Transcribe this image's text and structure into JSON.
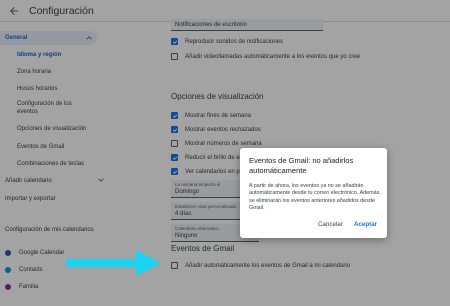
{
  "header": {
    "title": "Configuración",
    "back_icon": "arrow-back-icon"
  },
  "sidebar": {
    "general": "General",
    "sub_items": [
      "Idioma y región",
      "Zona horaria",
      "Husos horarios",
      "Configuración de los eventos",
      "Opciones de visualización",
      "Eventos de Gmail",
      "Combinaciones de teclas"
    ],
    "add_calendar": "Añadir calendario",
    "import_export": "Importar y exportar",
    "my_calendars_heading": "Configuración de mis calendarios",
    "calendars": [
      {
        "name": "Google Calendar",
        "color": "#3f51b5"
      },
      {
        "name": "Contacts",
        "color": "#039be5"
      },
      {
        "name": "Familia",
        "color": "#8e24aa"
      }
    ]
  },
  "main": {
    "notif_field": "Notificaciones de escritorio",
    "notif_options": [
      {
        "label": "Reproducir sonidos de notificaciones",
        "checked": true
      },
      {
        "label": "Añadir videollamadas automáticamente a los eventos que yo cree",
        "checked": false
      }
    ],
    "view_title": "Opciones de visualización",
    "view_options": [
      {
        "label": "Mostrar fines de semana",
        "checked": true
      },
      {
        "label": "Mostrar eventos rechazados",
        "checked": true
      },
      {
        "label": "Mostrar números de semana",
        "checked": false
      },
      {
        "label": "Reducir el brillo de e",
        "checked": true
      },
      {
        "label": "Ver calendarios en p",
        "checked": true
      }
    ],
    "selects": [
      {
        "label": "La semana empieza el",
        "value": "Domingo"
      },
      {
        "label": "Establecer vista personalizada",
        "value": "4 días"
      },
      {
        "label": "Calendario alternativo",
        "value": "Ninguno"
      }
    ],
    "gmail_title": "Eventos de Gmail",
    "gmail_option": "Añadir automáticamente los eventos de Gmail a mi calendario"
  },
  "dialog": {
    "title": "Eventos de Gmail: no añadirlos automáticamente",
    "body": "A partir de ahora, los eventos ya no se añadirán automáticamente desde tu correo electrónico. Además, se eliminarán los eventos anteriores añadidos desde Gmail.",
    "cancel": "Cancelar",
    "accept": "Aceptar"
  },
  "colors": {
    "accent": "#1a73e8",
    "arrow": "#19d3f0",
    "selected_bg": "#e8f0fe"
  }
}
